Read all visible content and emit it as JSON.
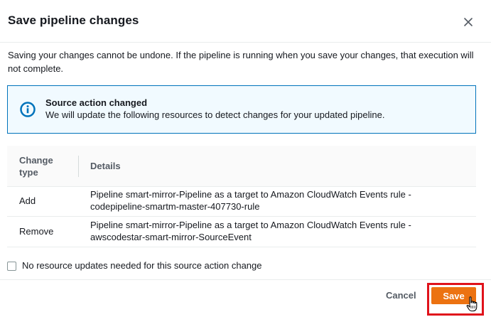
{
  "dialog": {
    "title": "Save pipeline changes",
    "description": "Saving your changes cannot be undone. If the pipeline is running when you save your changes, that execution will not complete."
  },
  "alert": {
    "icon": "info-icon",
    "title": "Source action changed",
    "text": "We will update the following resources to detect changes for your updated pipeline."
  },
  "table": {
    "headers": [
      "Change type",
      "Details"
    ],
    "header_change_line1": "Change",
    "header_change_line2": "type",
    "rows": [
      {
        "type": "Add",
        "details": "Pipeline smart-mirror-Pipeline as a target to Amazon CloudWatch Events rule - codepipeline-smartm-master-407730-rule"
      },
      {
        "type": "Remove",
        "details": "Pipeline smart-mirror-Pipeline as a target to Amazon CloudWatch Events rule - awscodestar-smart-mirror-SourceEvent"
      }
    ]
  },
  "checkbox": {
    "label": "No resource updates needed for this source action change",
    "checked": false
  },
  "footer": {
    "cancel_label": "Cancel",
    "save_label": "Save"
  },
  "colors": {
    "primary_button": "#ec7211",
    "info_accent": "#0073bb",
    "highlight_box": "#e0121b"
  }
}
